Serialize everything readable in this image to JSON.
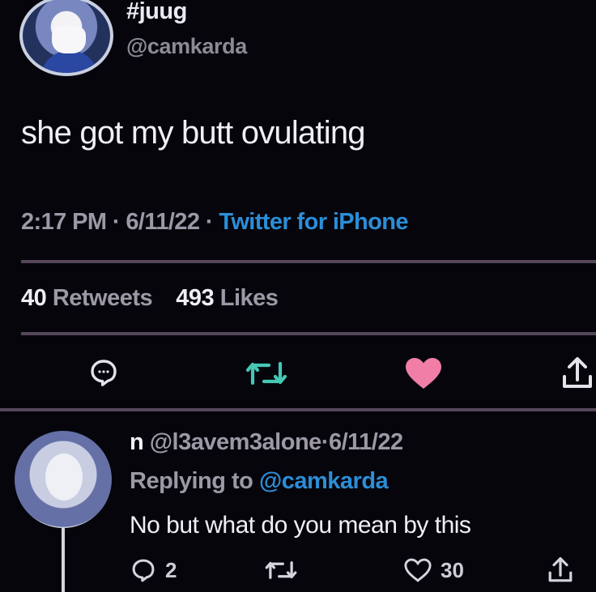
{
  "tweet": {
    "display_name": "#juug",
    "handle": "@camkarda",
    "text": "she got my butt ovulating",
    "time": "2:17 PM",
    "date": "6/11/22",
    "separator": "·",
    "source": "Twitter for iPhone",
    "retweets_count": "40",
    "retweets_label": "Retweets",
    "likes_count": "493",
    "likes_label": "Likes"
  },
  "actions": {
    "reply_icon": "reply-icon",
    "retweet_icon": "retweet-icon",
    "like_icon": "heart-icon",
    "share_icon": "share-icon"
  },
  "reply": {
    "display_name": "n",
    "handle": "@l3avem3alone",
    "separator": "·",
    "date": "6/11/22",
    "replying_to_label": "Replying to",
    "replying_to_mention": "@camkarda",
    "text": "No but what do you mean by this",
    "reply_count": "2",
    "like_count": "30"
  },
  "colors": {
    "background": "#06050b",
    "accent_blue": "#2b8ed8",
    "retweet_green": "#46c7b6",
    "like_pink": "#f07ea7",
    "divider": "#55465a"
  }
}
